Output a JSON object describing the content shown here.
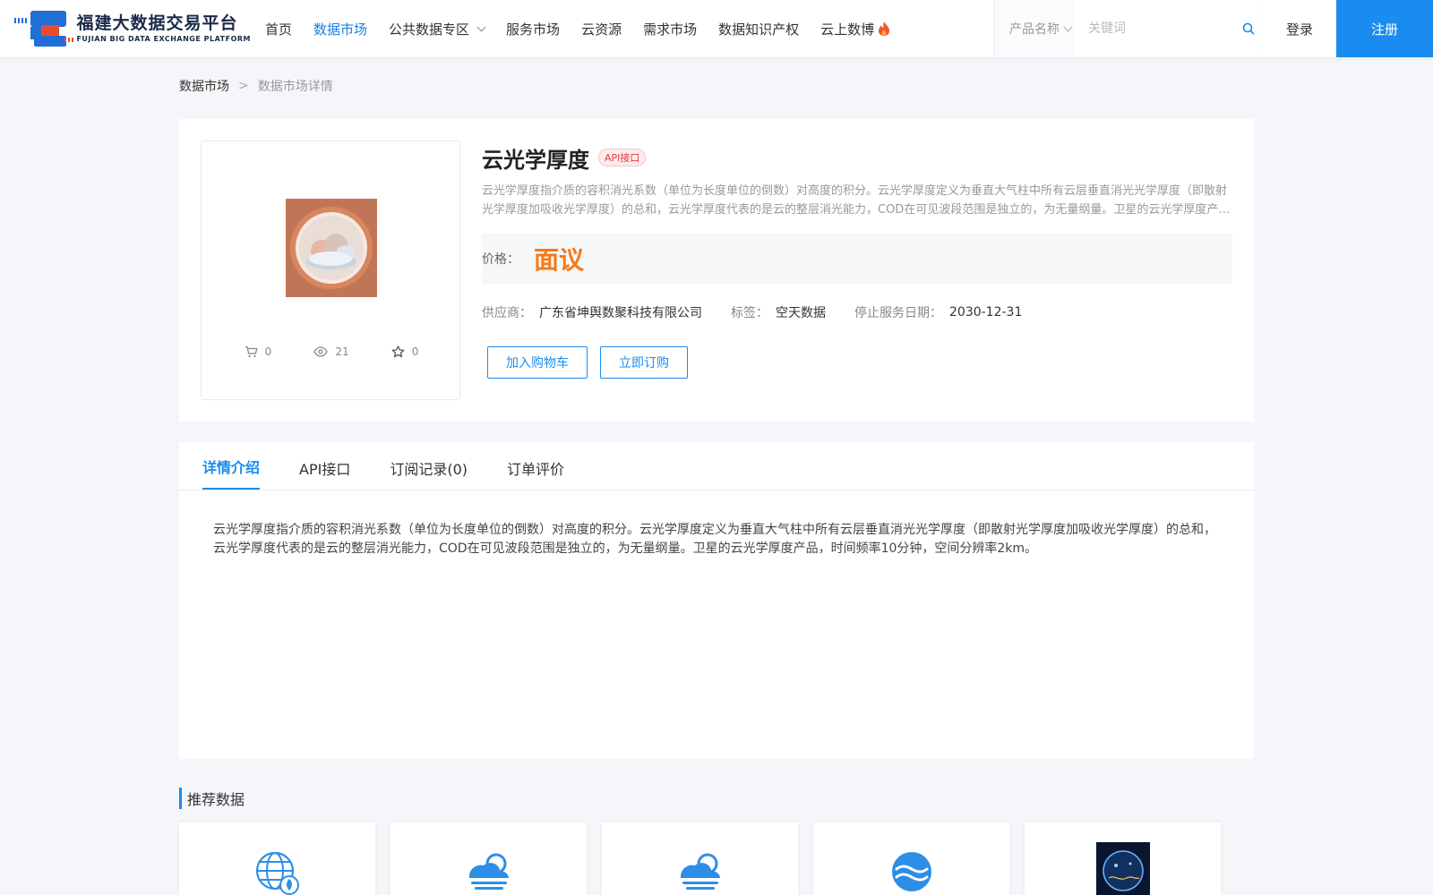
{
  "header": {
    "logo_cn": "福建大数据交易平台",
    "logo_en": "FUJIAN BIG DATA EXCHANGE  PLATFORM",
    "nav": [
      {
        "label": "首页"
      },
      {
        "label": "数据市场"
      },
      {
        "label": "公共数据专区"
      },
      {
        "label": "服务市场"
      },
      {
        "label": "云资源"
      },
      {
        "label": "需求市场"
      },
      {
        "label": "数据知识产权"
      },
      {
        "label": "云上数博"
      }
    ],
    "search_select": "产品名称",
    "search_placeholder": "关键词",
    "login": "登录",
    "register": "注册"
  },
  "breadcrumb": {
    "parent": "数据市场",
    "separator": ">",
    "current": "数据市场详情"
  },
  "product": {
    "title": "云光学厚度",
    "badge": "API接口",
    "description": "云光学厚度指介质的容积消光系数（单位为长度单位的倒数）对高度的积分。云光学厚度定义为垂直大气柱中所有云层垂直消光光学厚度（即散射光学厚度加吸收光学厚度）的总和，云光学厚度代表的是云的整层消光能力，COD在可见波段范围是独立的，为无量纲量。卫星的云光学厚度产品，时间频率10分钟，空间分辨率2km。",
    "price_label": "价格：",
    "price_value": "面议",
    "supplier_label": "供应商：",
    "supplier_value": "广东省坤舆数聚科技有限公司",
    "tag_label": "标签：",
    "tag_value": "空天数据",
    "end_date_label": "停止服务日期：",
    "end_date_value": "2030-12-31",
    "stats": {
      "cart": "0",
      "views": "21",
      "favorites": "0"
    },
    "add_cart": "加入购物车",
    "subscribe": "立即订购"
  },
  "detail": {
    "tabs": [
      {
        "label": "详情介绍"
      },
      {
        "label": "API接口"
      },
      {
        "label": "订阅记录(0)"
      },
      {
        "label": "订单评价"
      }
    ],
    "content": "云光学厚度指介质的容积消光系数（单位为长度单位的倒数）对高度的积分。云光学厚度定义为垂直大气柱中所有云层垂直消光光学厚度（即散射光学厚度加吸收光学厚度）的总和，云光学厚度代表的是云的整层消光能力，COD在可见波段范围是独立的，为无量纲量。卫星的云光学厚度产品，时间频率10分钟，空间分辨率2km。"
  },
  "recommend": {
    "title": "推荐数据",
    "items": [
      {
        "icon": "globe-leaf-icon"
      },
      {
        "icon": "cloud-sun-icon"
      },
      {
        "icon": "cloud-sun-icon"
      },
      {
        "icon": "water-wave-icon"
      },
      {
        "icon": "earth-photo-icon"
      }
    ]
  },
  "colors": {
    "accent": "#1a8cf0",
    "price": "#f57a1a",
    "badge": "#e23b3b"
  }
}
